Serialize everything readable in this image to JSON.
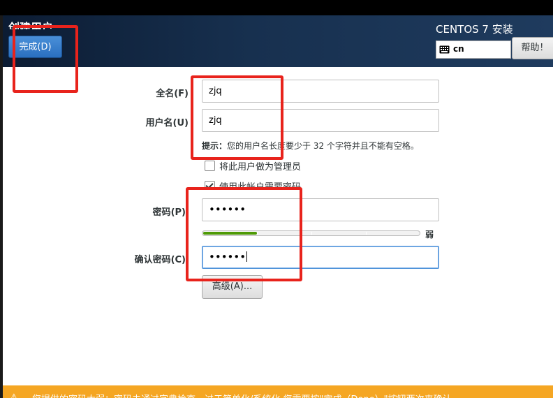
{
  "header": {
    "spoke_title": "创建用户",
    "done_label": "完成(D)",
    "product_title": "CENTOS 7 安装",
    "keyboard_layout": "cn",
    "help_label": "帮助！"
  },
  "form": {
    "fullname_label": "全名(F)",
    "fullname_value": "zjq",
    "username_label": "用户名(U)",
    "username_value": "zjq",
    "hint_prefix": "提示：",
    "hint_text": "您的用户名长度要少于 32 个字符并且不能有空格。",
    "admin_checkbox_label": "将此用户做为管理员",
    "admin_checked": false,
    "require_password_label": "使用此帐户需要密码",
    "require_password_checked": true,
    "password_label": "密码(P)",
    "password_value": "••••••",
    "strength_label": "弱",
    "strength_fraction": 0.25,
    "confirm_label": "确认密码(C)",
    "confirm_value": "••••••",
    "advanced_label": "高级(A)..."
  },
  "warning": {
    "icon": "warning-icon",
    "text": "您提供的密码太弱：密码未通过字典检查 - 过于简单化/系统化 您需要按\"完成（Done）\"按钮两次来确认。"
  },
  "colors": {
    "header_bg": "#17304f",
    "accent": "#4a90d9",
    "strength_fill": "#4e9a06",
    "warning_bg": "#f5a623",
    "annotation": "#e8231c"
  }
}
